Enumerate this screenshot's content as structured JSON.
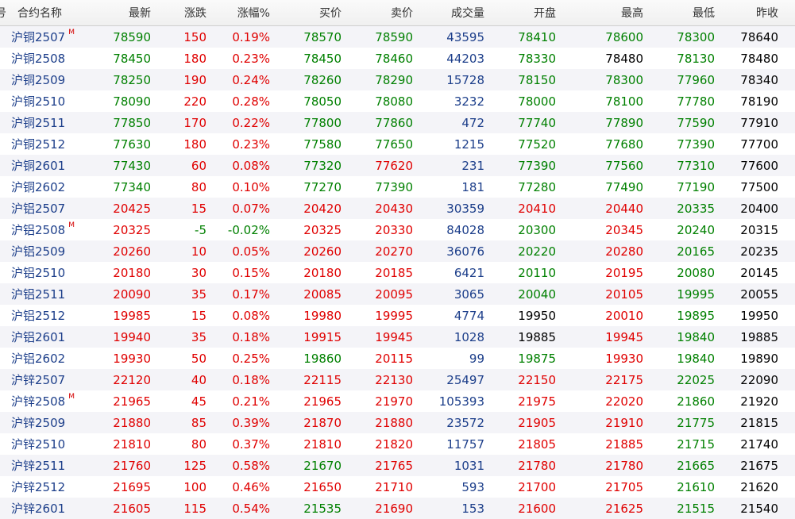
{
  "colors": {
    "up": "#e00000",
    "down": "#008000",
    "flat": "#000000",
    "name": "#1c3e8a",
    "volume": "#1c3e8a"
  },
  "header": {
    "seq": "号",
    "name": "合约名称",
    "last": "最新",
    "change": "涨跌",
    "pct": "涨幅%",
    "bid": "买价",
    "ask": "卖价",
    "volume": "成交量",
    "open": "开盘",
    "high": "最高",
    "low": "最低",
    "prev_close": "昨收"
  },
  "rows": [
    {
      "name": "沪铜2507",
      "flag": "M",
      "last": "78590",
      "change": "150",
      "pct": "0.19%",
      "bid": "78570",
      "ask": "78590",
      "volume": "43595",
      "open": "78410",
      "high": "78600",
      "low": "78300",
      "prev_close": "78640"
    },
    {
      "name": "沪铜2508",
      "flag": "",
      "last": "78450",
      "change": "180",
      "pct": "0.23%",
      "bid": "78450",
      "ask": "78460",
      "volume": "44203",
      "open": "78330",
      "high": "78480",
      "low": "78130",
      "prev_close": "78480"
    },
    {
      "name": "沪铜2509",
      "flag": "",
      "last": "78250",
      "change": "190",
      "pct": "0.24%",
      "bid": "78260",
      "ask": "78290",
      "volume": "15728",
      "open": "78150",
      "high": "78300",
      "low": "77960",
      "prev_close": "78340"
    },
    {
      "name": "沪铜2510",
      "flag": "",
      "last": "78090",
      "change": "220",
      "pct": "0.28%",
      "bid": "78050",
      "ask": "78080",
      "volume": "3232",
      "open": "78000",
      "high": "78100",
      "low": "77780",
      "prev_close": "78190"
    },
    {
      "name": "沪铜2511",
      "flag": "",
      "last": "77850",
      "change": "170",
      "pct": "0.22%",
      "bid": "77800",
      "ask": "77860",
      "volume": "472",
      "open": "77740",
      "high": "77890",
      "low": "77590",
      "prev_close": "77910"
    },
    {
      "name": "沪铜2512",
      "flag": "",
      "last": "77630",
      "change": "180",
      "pct": "0.23%",
      "bid": "77580",
      "ask": "77650",
      "volume": "1215",
      "open": "77520",
      "high": "77680",
      "low": "77390",
      "prev_close": "77700"
    },
    {
      "name": "沪铜2601",
      "flag": "",
      "last": "77430",
      "change": "60",
      "pct": "0.08%",
      "bid": "77320",
      "ask": "77620",
      "volume": "231",
      "open": "77390",
      "high": "77560",
      "low": "77310",
      "prev_close": "77600"
    },
    {
      "name": "沪铜2602",
      "flag": "",
      "last": "77340",
      "change": "80",
      "pct": "0.10%",
      "bid": "77270",
      "ask": "77390",
      "volume": "181",
      "open": "77280",
      "high": "77490",
      "low": "77190",
      "prev_close": "77500"
    },
    {
      "name": "沪铝2507",
      "flag": "",
      "last": "20425",
      "change": "15",
      "pct": "0.07%",
      "bid": "20420",
      "ask": "20430",
      "volume": "30359",
      "open": "20410",
      "high": "20440",
      "low": "20335",
      "prev_close": "20400"
    },
    {
      "name": "沪铝2508",
      "flag": "M",
      "last": "20325",
      "change": "-5",
      "pct": "-0.02%",
      "bid": "20325",
      "ask": "20330",
      "volume": "84028",
      "open": "20300",
      "high": "20345",
      "low": "20240",
      "prev_close": "20315"
    },
    {
      "name": "沪铝2509",
      "flag": "",
      "last": "20260",
      "change": "10",
      "pct": "0.05%",
      "bid": "20260",
      "ask": "20270",
      "volume": "36076",
      "open": "20220",
      "high": "20280",
      "low": "20165",
      "prev_close": "20235"
    },
    {
      "name": "沪铝2510",
      "flag": "",
      "last": "20180",
      "change": "30",
      "pct": "0.15%",
      "bid": "20180",
      "ask": "20185",
      "volume": "6421",
      "open": "20110",
      "high": "20195",
      "low": "20080",
      "prev_close": "20145"
    },
    {
      "name": "沪铝2511",
      "flag": "",
      "last": "20090",
      "change": "35",
      "pct": "0.17%",
      "bid": "20085",
      "ask": "20095",
      "volume": "3065",
      "open": "20040",
      "high": "20105",
      "low": "19995",
      "prev_close": "20055"
    },
    {
      "name": "沪铝2512",
      "flag": "",
      "last": "19985",
      "change": "15",
      "pct": "0.08%",
      "bid": "19980",
      "ask": "19995",
      "volume": "4774",
      "open": "19950",
      "high": "20010",
      "low": "19895",
      "prev_close": "19950"
    },
    {
      "name": "沪铝2601",
      "flag": "",
      "last": "19940",
      "change": "35",
      "pct": "0.18%",
      "bid": "19915",
      "ask": "19945",
      "volume": "1028",
      "open": "19885",
      "high": "19945",
      "low": "19840",
      "prev_close": "19885"
    },
    {
      "name": "沪铝2602",
      "flag": "",
      "last": "19930",
      "change": "50",
      "pct": "0.25%",
      "bid": "19860",
      "ask": "20115",
      "volume": "99",
      "open": "19875",
      "high": "19930",
      "low": "19840",
      "prev_close": "19890"
    },
    {
      "name": "沪锌2507",
      "flag": "",
      "last": "22120",
      "change": "40",
      "pct": "0.18%",
      "bid": "22115",
      "ask": "22130",
      "volume": "25497",
      "open": "22150",
      "high": "22175",
      "low": "22025",
      "prev_close": "22090"
    },
    {
      "name": "沪锌2508",
      "flag": "M",
      "last": "21965",
      "change": "45",
      "pct": "0.21%",
      "bid": "21965",
      "ask": "21970",
      "volume": "105393",
      "open": "21975",
      "high": "22020",
      "low": "21860",
      "prev_close": "21920"
    },
    {
      "name": "沪锌2509",
      "flag": "",
      "last": "21880",
      "change": "85",
      "pct": "0.39%",
      "bid": "21870",
      "ask": "21880",
      "volume": "23572",
      "open": "21905",
      "high": "21910",
      "low": "21775",
      "prev_close": "21815"
    },
    {
      "name": "沪锌2510",
      "flag": "",
      "last": "21810",
      "change": "80",
      "pct": "0.37%",
      "bid": "21810",
      "ask": "21820",
      "volume": "11757",
      "open": "21805",
      "high": "21885",
      "low": "21715",
      "prev_close": "21740"
    },
    {
      "name": "沪锌2511",
      "flag": "",
      "last": "21760",
      "change": "125",
      "pct": "0.58%",
      "bid": "21670",
      "ask": "21765",
      "volume": "1031",
      "open": "21780",
      "high": "21780",
      "low": "21665",
      "prev_close": "21675"
    },
    {
      "name": "沪锌2512",
      "flag": "",
      "last": "21695",
      "change": "100",
      "pct": "0.46%",
      "bid": "21650",
      "ask": "21710",
      "volume": "593",
      "open": "21700",
      "high": "21705",
      "low": "21610",
      "prev_close": "21620"
    },
    {
      "name": "沪锌2601",
      "flag": "",
      "last": "21605",
      "change": "115",
      "pct": "0.54%",
      "bid": "21535",
      "ask": "21690",
      "volume": "153",
      "open": "21600",
      "high": "21625",
      "low": "21515",
      "prev_close": "21540"
    }
  ]
}
